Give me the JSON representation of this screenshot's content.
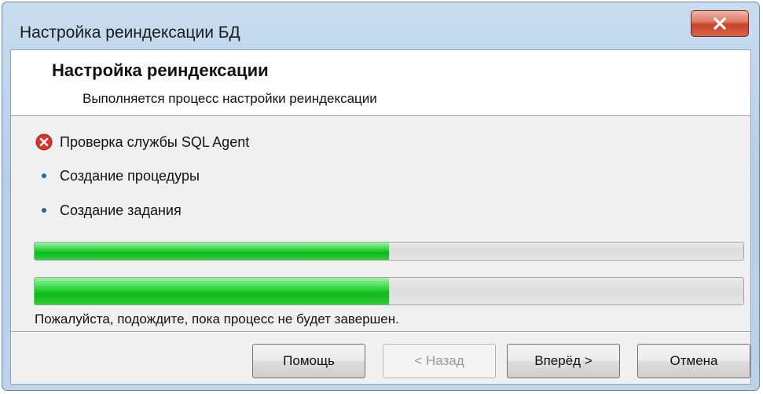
{
  "window": {
    "title": "Настройка реиндексации БД",
    "close_icon": "close-icon"
  },
  "header": {
    "title": "Настройка реиндексации",
    "subtitle": "Выполняется процесс настройки реиндексации"
  },
  "steps": [
    {
      "label": "Проверка службы SQL Agent",
      "icon": "error-icon",
      "status": "error"
    },
    {
      "label": "Создание процедуры",
      "icon": "bullet-icon",
      "status": "pending"
    },
    {
      "label": "Создание задания",
      "icon": "bullet-icon",
      "status": "pending"
    }
  ],
  "progress": {
    "bar1_percent": 50,
    "bar2_percent": 50,
    "status_text": "Пожалуйста, подождите, пока процесс не будет завершен."
  },
  "buttons": {
    "help": "Помощь",
    "back": "< Назад",
    "next": "Вперёд >",
    "cancel": "Отмена"
  },
  "colors": {
    "progress_fill": "#17bf26",
    "error_icon": "#d9342b"
  }
}
